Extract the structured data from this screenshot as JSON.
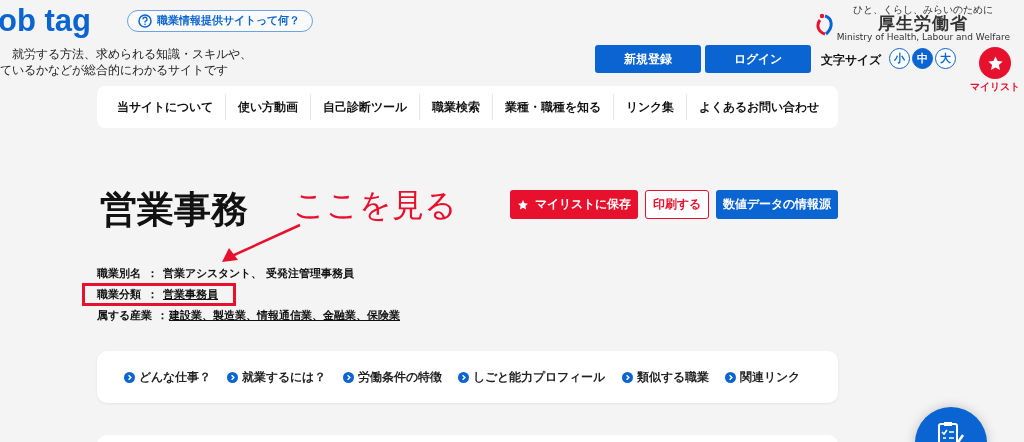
{
  "header": {
    "logo": "ob tag",
    "tagline": [
      "就労する方法、求められる知識・スキルや、",
      "ているかなどが総合的にわかるサイトです"
    ],
    "about_link": "職業情報提供サイトって何？",
    "ministry": {
      "slogan": "ひと、くらし、みらいのために",
      "name": "厚生労働省",
      "english": "Ministry of Health, Labour and Welfare"
    },
    "buttons": [
      "新規登録",
      "ログイン"
    ],
    "font_size": {
      "label": "文字サイズ",
      "options": [
        {
          "label": "小",
          "selected": false
        },
        {
          "label": "中",
          "selected": true
        },
        {
          "label": "大",
          "selected": false
        }
      ]
    },
    "mylist": "マイリスト"
  },
  "nav": [
    "当サイトについて",
    "使い方動画",
    "自己診断ツール",
    "職業検索",
    "業種・職種を知る",
    "リンク集",
    "よくあるお問い合わせ"
  ],
  "job": {
    "title": "営業事務",
    "actions": [
      {
        "label": "マイリストに保存",
        "kind": "save"
      },
      {
        "label": "印刷する",
        "kind": "outline"
      },
      {
        "label": "数値データの情報源",
        "kind": "info"
      }
    ],
    "details": [
      {
        "label": "職業別名",
        "separator": "：",
        "value": "営業アシスタント、 受発注管理事務員",
        "linked": false,
        "highlighted": false
      },
      {
        "label": "職業分類",
        "separator": "：",
        "value": "営業事務員",
        "linked": true,
        "highlighted": true
      },
      {
        "label": "属する産業",
        "separator": "：",
        "value": "建設業、製造業、情報通信業、金融業、保険業",
        "linked": true,
        "highlighted": false
      }
    ]
  },
  "annotation": {
    "text": "ここを見る"
  },
  "sections": [
    "どんな仕事？",
    "就業するには？",
    "労働条件の特徴",
    "しごと能力プロフィール",
    "類似する職業",
    "関連リンク"
  ]
}
